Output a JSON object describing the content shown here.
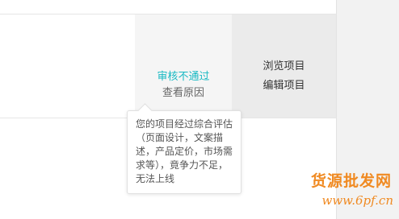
{
  "project_row": {
    "status": "审核不通过",
    "view_reason": "查看原因",
    "actions": {
      "browse": "浏览项目",
      "edit": "编辑项目"
    }
  },
  "tooltip": {
    "message": "您的项目经过综合评估（页面设计，文案描述，产品定价，市场需求等），竟争力不足，无法上线"
  },
  "watermark": {
    "line1": "货源批发网",
    "line2": "www.6pf.cn"
  },
  "colors": {
    "status_rejected": "#19b9c3",
    "watermark": "#f08a22"
  }
}
